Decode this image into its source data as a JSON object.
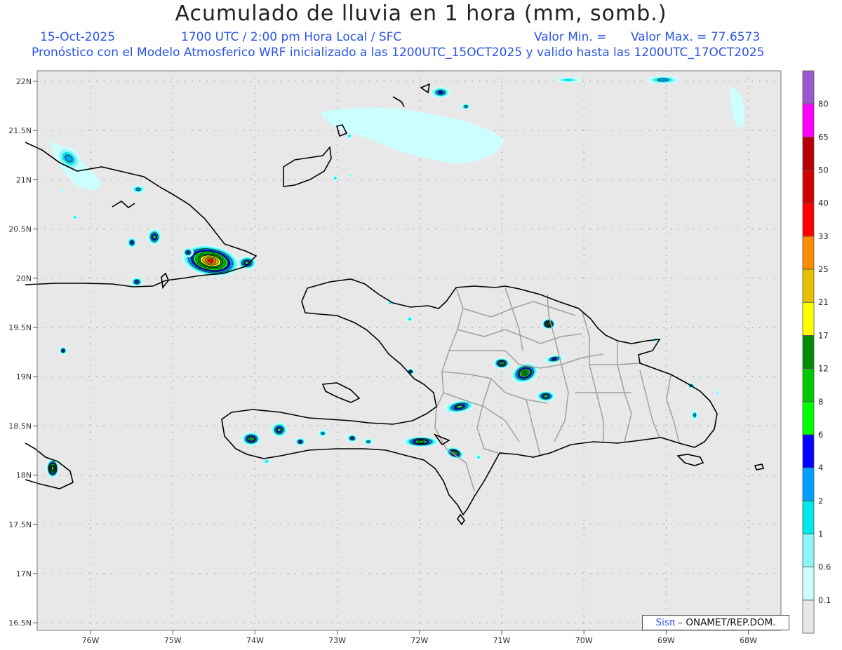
{
  "header": {
    "title": "Acumulado de lluvia en 1 hora (mm, somb.)",
    "date": "15-Oct-2025",
    "time": "1700 UTC / 2:00 pm Hora Local / SFC",
    "valor_min_label": "Valor Min. =",
    "valor_max": "Valor Max. = 77.6573",
    "model_line": "Pronóstico con el Modelo Atmosferico WRF inicializado a las 1200UTC_15OCT2025 y valido hasta las  1200UTC_17OCT2025"
  },
  "map": {
    "background": "#e8e8e8",
    "coast_color": "#000000",
    "border_color": "#a0a0a0",
    "lat_ticks": [
      "22N",
      "21.5N",
      "21N",
      "20.5N",
      "20N",
      "19.5N",
      "19N",
      "18.5N",
      "18N",
      "17.5N",
      "17N",
      "16.5N"
    ],
    "lon_ticks": [
      "76W",
      "75W",
      "74W",
      "73W",
      "72W",
      "71W",
      "70W",
      "69W",
      "68W"
    ]
  },
  "legend": {
    "labels": [
      "0.1",
      "0.6",
      "1",
      "2",
      "4",
      "6",
      "8",
      "12",
      "17",
      "21",
      "25",
      "33",
      "40",
      "50",
      "65",
      "80"
    ],
    "colors": [
      "#e8e8e8",
      "#ccffff",
      "#8cf5f5",
      "#00e8e8",
      "#00a0ff",
      "#0000ff",
      "#00ff00",
      "#00c800",
      "#008c00",
      "#ffff00",
      "#e6c000",
      "#ff8c00",
      "#ff0000",
      "#d20000",
      "#b40000",
      "#ff00ff",
      "#9b59d0"
    ]
  },
  "credit": {
    "sis": "Sis",
    "pi": "π",
    "rest": "– ONAMET/REP.DOM."
  }
}
